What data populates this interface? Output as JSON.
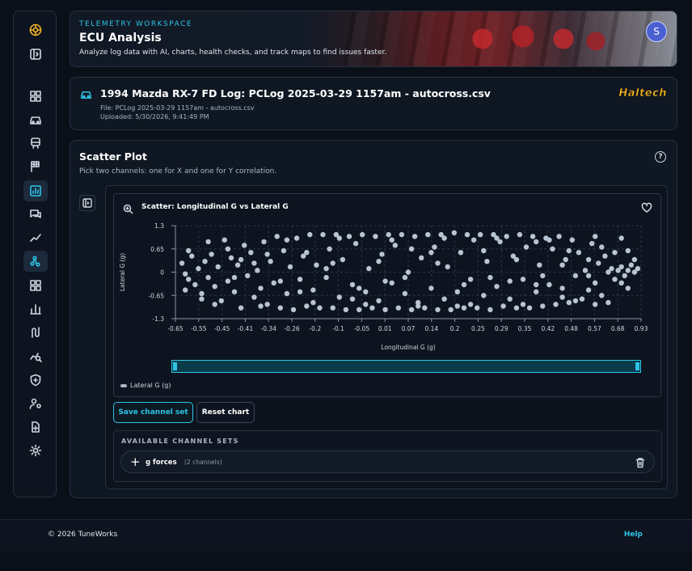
{
  "header": {
    "kicker": "TELEMETRY WORKSPACE",
    "title": "ECU Analysis",
    "subtitle": "Analyze log data with AI, charts, health checks, and track maps to find issues faster.",
    "avatar_letter": "S"
  },
  "sidebar": {
    "items": [
      {
        "icon": "logo-icon"
      },
      {
        "icon": "collapse-icon"
      },
      {
        "icon": "dashboard-icon"
      },
      {
        "icon": "car-icon"
      },
      {
        "icon": "train-icon"
      },
      {
        "icon": "flag-icon"
      },
      {
        "icon": "chart-icon",
        "active": true
      },
      {
        "icon": "chat-icon"
      },
      {
        "icon": "trend-icon"
      },
      {
        "icon": "scatter-icon"
      },
      {
        "icon": "grid-icon"
      },
      {
        "icon": "bar-chart-icon"
      },
      {
        "icon": "route-icon"
      },
      {
        "icon": "analytics-search-icon"
      },
      {
        "icon": "shield-icon"
      },
      {
        "icon": "user-settings-icon"
      },
      {
        "icon": "file-add-icon"
      },
      {
        "icon": "gear-icon"
      }
    ]
  },
  "log": {
    "title": "1994 Mazda RX-7 FD Log: PCLog 2025-03-29 1157am - autocross.csv",
    "file": "File: PCLog 2025-03-29 1157am - autocross.csv",
    "uploaded": "Uploaded: 5/30/2026, 9:41:49 PM",
    "brand": "Haltech"
  },
  "panel": {
    "title": "Scatter Plot",
    "description": "Pick two channels: one for X and one for Y correlation.",
    "save_label": "Save channel set",
    "reset_label": "Reset chart",
    "sets_title": "AVAILABLE CHANNEL SETS",
    "sets": [
      {
        "name": "g forces",
        "count": "(2 channels)"
      }
    ]
  },
  "chart_data": {
    "type": "scatter",
    "title": "Scatter: Longitudinal G vs Lateral G",
    "xlabel": "Longitudinal G (g)",
    "ylabel": "Lateral G (g)",
    "legend": [
      "Lateral G (g)"
    ],
    "x_ticks": [
      "-0.65",
      "-0.55",
      "-0.45",
      "-0.41",
      "-0.34",
      "-0.26",
      "-0.2",
      "-0.1",
      "-0.05",
      "0.01",
      "0.07",
      "0.14",
      "0.2",
      "0.25",
      "0.29",
      "0.35",
      "0.42",
      "0.48",
      "0.57",
      "0.68",
      "0.93"
    ],
    "y_ticks": [
      "1.3",
      "0.65",
      "0",
      "-0.65",
      "-1.3"
    ],
    "ylim": [
      -1.3,
      1.3
    ],
    "point_color": "#b8c4d4",
    "points": [
      [
        -0.68,
        0.25
      ],
      [
        -0.67,
        -0.05
      ],
      [
        -0.66,
        -0.2
      ],
      [
        -0.65,
        0.45
      ],
      [
        -0.64,
        -0.35
      ],
      [
        -0.63,
        0.1
      ],
      [
        -0.62,
        -0.6
      ],
      [
        -0.61,
        0.3
      ],
      [
        -0.6,
        -0.15
      ],
      [
        -0.59,
        0.5
      ],
      [
        -0.58,
        -0.4
      ],
      [
        -0.57,
        0.15
      ],
      [
        -0.56,
        -0.8
      ],
      [
        -0.55,
        0.9
      ],
      [
        -0.54,
        -0.25
      ],
      [
        -0.53,
        0.4
      ],
      [
        -0.52,
        -0.55
      ],
      [
        -0.51,
        0.2
      ],
      [
        -0.5,
        -1.0
      ],
      [
        -0.49,
        0.75
      ],
      [
        -0.48,
        -0.1
      ],
      [
        -0.47,
        0.55
      ],
      [
        -0.46,
        -0.7
      ],
      [
        -0.45,
        0.05
      ],
      [
        -0.44,
        -0.45
      ],
      [
        -0.43,
        0.85
      ],
      [
        -0.42,
        -0.9
      ],
      [
        -0.41,
        0.3
      ],
      [
        -0.4,
        -0.3
      ],
      [
        -0.39,
        1.0
      ],
      [
        -0.38,
        -1.0
      ],
      [
        -0.37,
        0.6
      ],
      [
        -0.36,
        -0.6
      ],
      [
        -0.35,
        0.15
      ],
      [
        -0.34,
        -1.05
      ],
      [
        -0.33,
        0.95
      ],
      [
        -0.32,
        -0.2
      ],
      [
        -0.31,
        0.45
      ],
      [
        -0.3,
        -0.95
      ],
      [
        -0.29,
        1.05
      ],
      [
        -0.28,
        -0.5
      ],
      [
        -0.27,
        0.2
      ],
      [
        -0.26,
        -1.0
      ],
      [
        -0.25,
        1.05
      ],
      [
        -0.24,
        -0.15
      ],
      [
        -0.23,
        0.65
      ],
      [
        -0.22,
        -1.0
      ],
      [
        -0.21,
        1.05
      ],
      [
        -0.2,
        -0.7
      ],
      [
        -0.19,
        0.35
      ],
      [
        -0.18,
        -1.05
      ],
      [
        -0.17,
        1.0
      ],
      [
        -0.16,
        -0.35
      ],
      [
        -0.15,
        0.8
      ],
      [
        -0.14,
        -1.05
      ],
      [
        -0.13,
        1.05
      ],
      [
        -0.12,
        -0.55
      ],
      [
        -0.11,
        0.1
      ],
      [
        -0.1,
        -1.0
      ],
      [
        -0.09,
        1.0
      ],
      [
        -0.08,
        -0.8
      ],
      [
        -0.07,
        0.5
      ],
      [
        -0.06,
        -1.05
      ],
      [
        -0.05,
        1.05
      ],
      [
        -0.04,
        -0.3
      ],
      [
        -0.03,
        0.75
      ],
      [
        -0.02,
        -1.0
      ],
      [
        -0.01,
        1.05
      ],
      [
        0.0,
        -0.6
      ],
      [
        0.01,
        0.0
      ],
      [
        0.02,
        -1.05
      ],
      [
        0.03,
        1.0
      ],
      [
        0.04,
        -0.85
      ],
      [
        0.05,
        0.4
      ],
      [
        0.06,
        -1.0
      ],
      [
        0.07,
        1.05
      ],
      [
        0.08,
        -0.45
      ],
      [
        0.09,
        0.7
      ],
      [
        0.1,
        -1.05
      ],
      [
        0.11,
        1.05
      ],
      [
        0.12,
        -0.75
      ],
      [
        0.13,
        0.15
      ],
      [
        0.14,
        -1.05
      ],
      [
        0.15,
        1.1
      ],
      [
        0.16,
        -0.95
      ],
      [
        0.17,
        0.55
      ],
      [
        0.18,
        -1.0
      ],
      [
        0.19,
        1.05
      ],
      [
        0.2,
        -0.2
      ],
      [
        0.21,
        0.9
      ],
      [
        0.22,
        -1.0
      ],
      [
        0.23,
        1.05
      ],
      [
        0.24,
        -0.65
      ],
      [
        0.25,
        0.3
      ],
      [
        0.26,
        -1.05
      ],
      [
        0.27,
        1.05
      ],
      [
        0.28,
        -0.4
      ],
      [
        0.29,
        0.85
      ],
      [
        0.3,
        -0.95
      ],
      [
        0.31,
        1.0
      ],
      [
        0.32,
        -0.75
      ],
      [
        0.33,
        0.45
      ],
      [
        0.34,
        -1.0
      ],
      [
        0.35,
        1.05
      ],
      [
        0.36,
        -0.2
      ],
      [
        0.37,
        0.7
      ],
      [
        0.38,
        -1.0
      ],
      [
        0.39,
        1.0
      ],
      [
        0.4,
        -0.55
      ],
      [
        0.41,
        0.2
      ],
      [
        0.42,
        -0.95
      ],
      [
        0.43,
        0.95
      ],
      [
        0.44,
        -0.35
      ],
      [
        0.45,
        0.65
      ],
      [
        0.46,
        -0.9
      ],
      [
        0.47,
        1.0
      ],
      [
        0.48,
        -0.7
      ],
      [
        0.49,
        0.35
      ],
      [
        0.5,
        -0.85
      ],
      [
        0.51,
        0.9
      ],
      [
        0.52,
        -0.1
      ],
      [
        0.53,
        0.55
      ],
      [
        0.54,
        -0.75
      ],
      [
        0.55,
        0.05
      ],
      [
        0.56,
        -0.5
      ],
      [
        0.57,
        0.8
      ],
      [
        0.58,
        -0.3
      ],
      [
        0.59,
        0.25
      ],
      [
        0.6,
        -0.65
      ],
      [
        0.61,
        0.45
      ],
      [
        0.62,
        0.0
      ],
      [
        0.63,
        0.1
      ],
      [
        0.64,
        -0.2
      ],
      [
        0.65,
        0.05
      ],
      [
        0.66,
        0.15
      ],
      [
        0.67,
        -0.1
      ],
      [
        0.68,
        0.05
      ],
      [
        0.69,
        0.2
      ],
      [
        0.7,
        0.0
      ],
      [
        0.71,
        0.1
      ],
      [
        -0.66,
        0.6
      ],
      [
        -0.58,
        -0.9
      ],
      [
        -0.5,
        0.35
      ],
      [
        -0.44,
        -0.95
      ],
      [
        -0.36,
        0.9
      ],
      [
        -0.28,
        -0.85
      ],
      [
        -0.2,
        0.95
      ],
      [
        -0.12,
        -0.9
      ],
      [
        -0.04,
        0.9
      ],
      [
        0.04,
        -0.95
      ],
      [
        0.12,
        0.95
      ],
      [
        0.2,
        -0.9
      ],
      [
        0.28,
        0.95
      ],
      [
        0.36,
        -0.9
      ],
      [
        0.44,
        0.9
      ],
      [
        0.52,
        -0.8
      ],
      [
        0.6,
        0.7
      ],
      [
        0.68,
        -0.45
      ],
      [
        -0.62,
        -0.75
      ],
      [
        -0.54,
        0.65
      ],
      [
        -0.46,
        0.25
      ],
      [
        -0.38,
        -0.25
      ],
      [
        -0.3,
        0.55
      ],
      [
        -0.22,
        0.25
      ],
      [
        -0.14,
        -0.45
      ],
      [
        -0.06,
        -0.25
      ],
      [
        0.02,
        0.65
      ],
      [
        0.1,
        0.25
      ],
      [
        0.18,
        -0.35
      ],
      [
        0.26,
        -0.15
      ],
      [
        0.34,
        0.35
      ],
      [
        0.42,
        -0.1
      ],
      [
        0.5,
        0.6
      ],
      [
        0.58,
        -0.9
      ],
      [
        0.66,
        -0.3
      ],
      [
        0.7,
        0.35
      ],
      [
        0.64,
        0.55
      ],
      [
        0.56,
        -0.1
      ],
      [
        0.48,
        0.2
      ],
      [
        0.4,
        0.85
      ],
      [
        -0.67,
        -0.5
      ],
      [
        -0.6,
        0.85
      ],
      [
        -0.52,
        -0.15
      ],
      [
        -0.42,
        0.5
      ],
      [
        -0.32,
        -0.55
      ],
      [
        -0.24,
        0.1
      ],
      [
        -0.16,
        -0.75
      ],
      [
        -0.08,
        0.3
      ],
      [
        0.0,
        -0.15
      ],
      [
        0.08,
        0.55
      ],
      [
        0.16,
        -0.55
      ],
      [
        0.24,
        0.6
      ],
      [
        0.32,
        -0.25
      ],
      [
        0.4,
        -0.35
      ],
      [
        0.48,
        -0.45
      ],
      [
        0.56,
        0.35
      ],
      [
        0.62,
        -0.85
      ],
      [
        0.68,
        0.6
      ],
      [
        0.66,
        0.95
      ],
      [
        0.58,
        1.0
      ]
    ]
  },
  "footer": {
    "copyright": "© 2026 TuneWorks",
    "help": "Help"
  }
}
